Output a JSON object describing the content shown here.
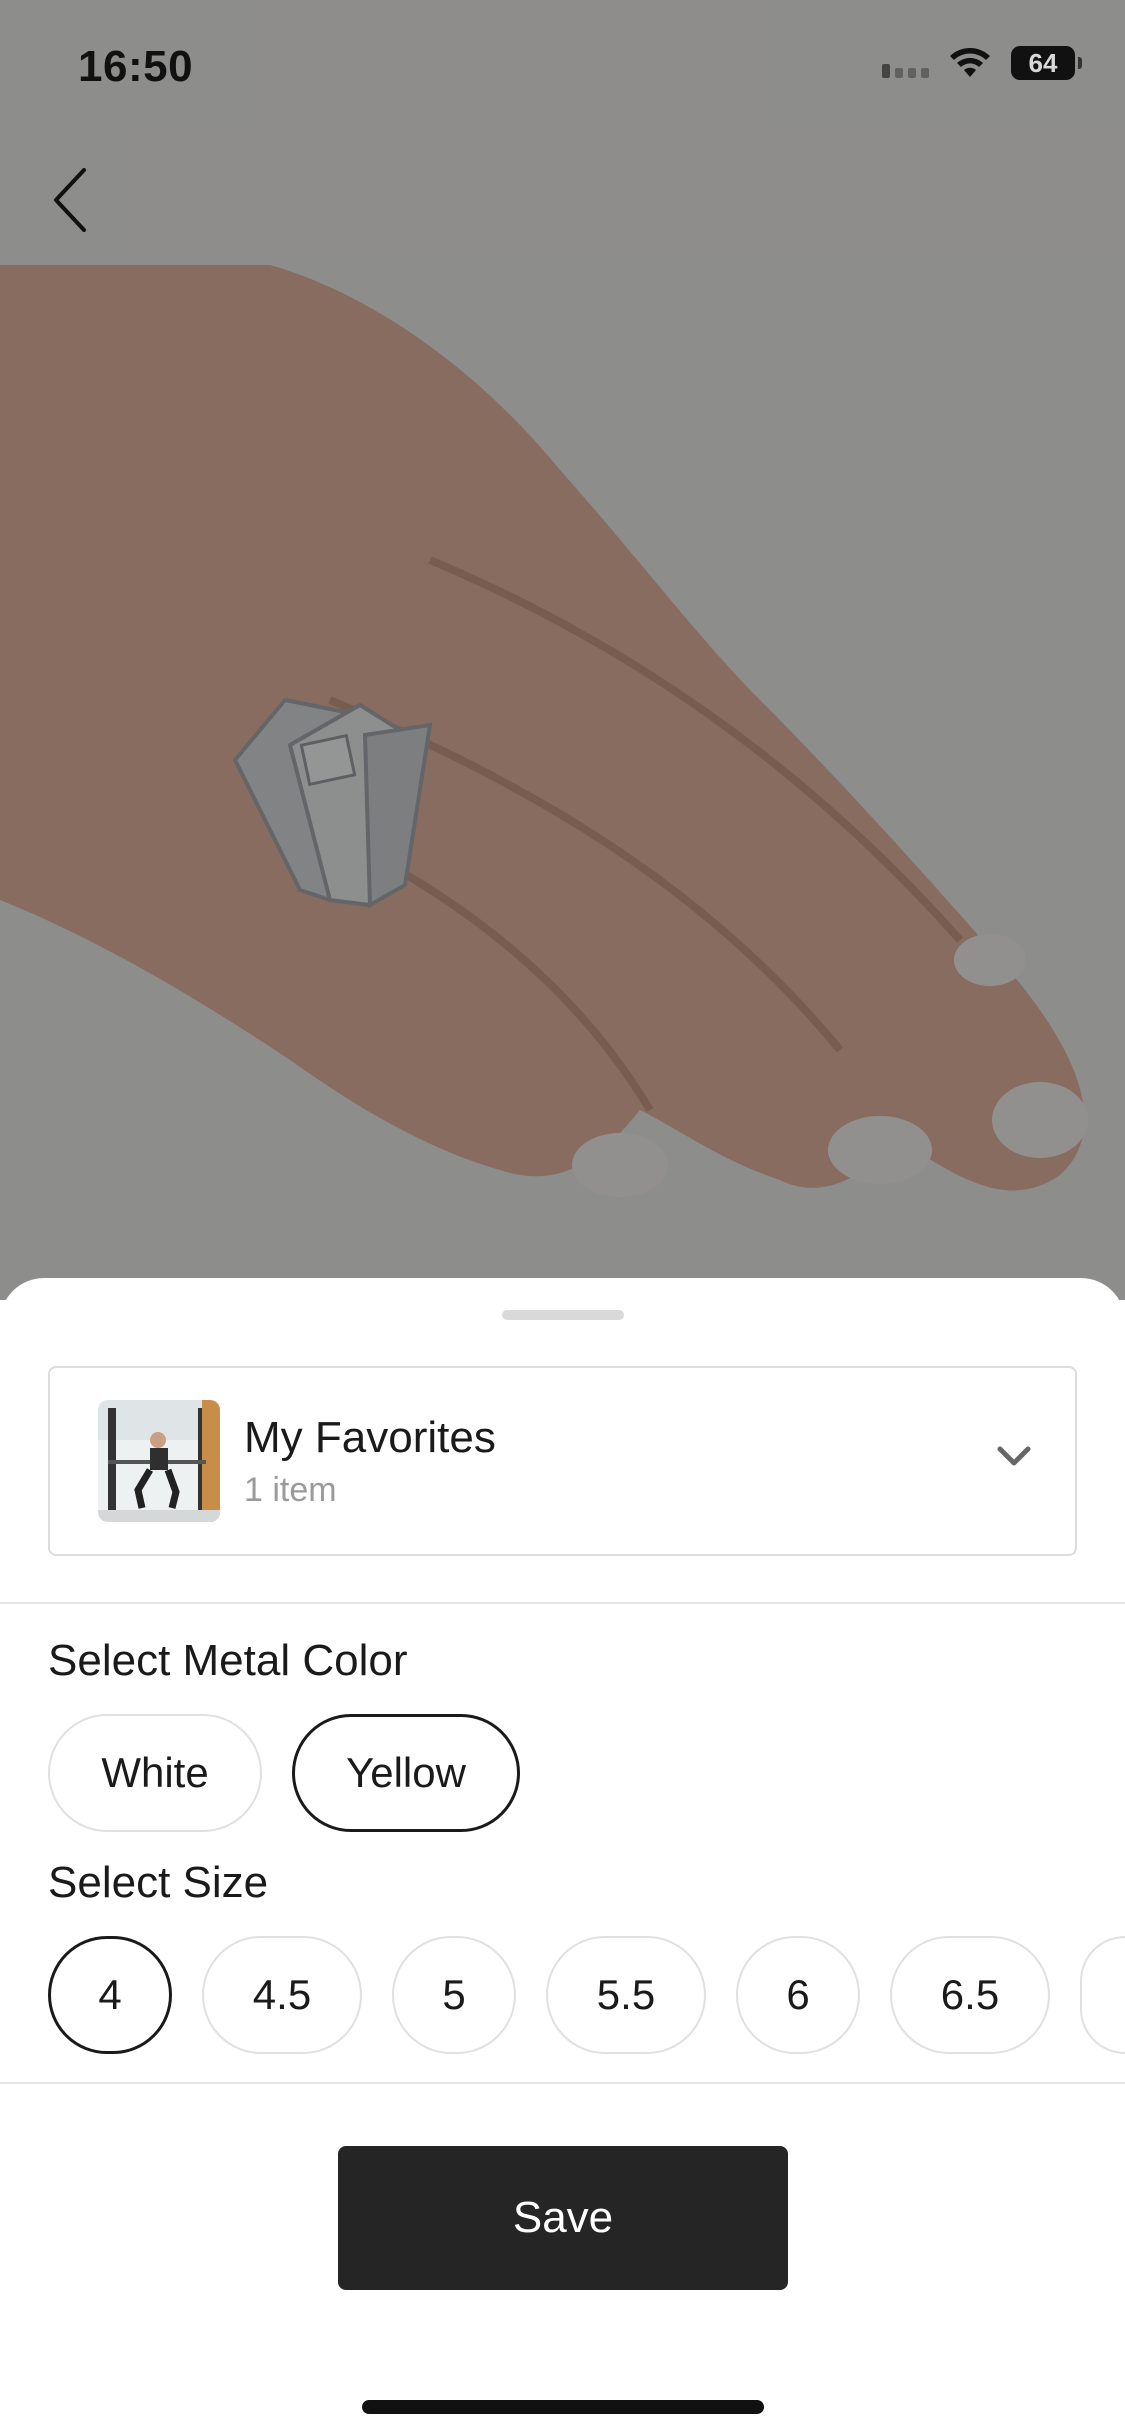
{
  "status_bar": {
    "time": "16:50",
    "battery_level": "64",
    "signal_icon": "cellular-signal-icon",
    "wifi_icon": "wifi-icon",
    "battery_icon": "battery-icon"
  },
  "nav": {
    "back_icon": "chevron-left-icon"
  },
  "product_image": {
    "description_icon": "ring-on-hand-photo"
  },
  "sheet": {
    "collection": {
      "title": "My Favorites",
      "count": "1 item",
      "thumbnail_icon": "fitness-photo-thumbnail",
      "dropdown_icon": "chevron-down-icon"
    },
    "metal_color": {
      "label": "Select Metal Color",
      "options": [
        "White",
        "Yellow"
      ],
      "selected": "Yellow"
    },
    "size": {
      "label": "Select Size",
      "options": [
        "4",
        "4.5",
        "5",
        "5.5",
        "6",
        "6.5"
      ],
      "selected": "4"
    },
    "save_label": "Save"
  },
  "colors": {
    "accent_dark": "#252525",
    "selected_border": "#1a1a1a",
    "divider": "#e6e6e6",
    "muted_text": "#9a9a9a"
  }
}
